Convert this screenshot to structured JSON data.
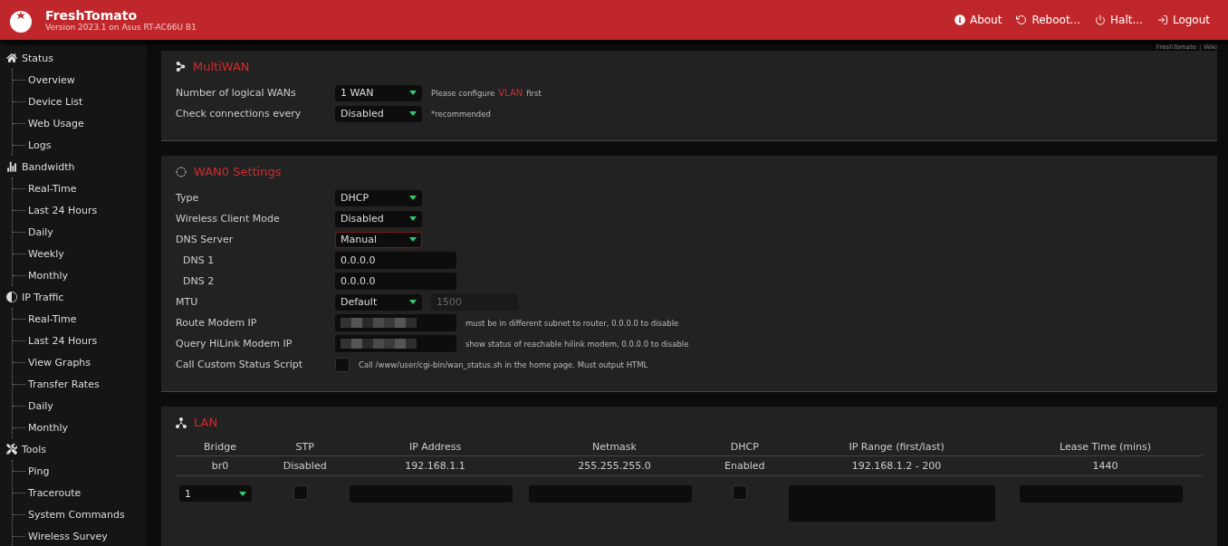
{
  "header": {
    "title": "FreshTomato",
    "subtitle": "Version 2023.1 on Asus RT-AC66U B1",
    "actions": [
      {
        "kind": "about",
        "label": "About"
      },
      {
        "kind": "reboot",
        "label": "Reboot..."
      },
      {
        "kind": "halt",
        "label": "Halt..."
      },
      {
        "kind": "logout",
        "label": "Logout"
      }
    ]
  },
  "top_links": [
    "FreshTomato",
    "|",
    "Wiki"
  ],
  "sidebar": {
    "groups": [
      {
        "kind": "status",
        "label": "Status",
        "children": [
          "Overview",
          "Device List",
          "Web Usage",
          "Logs"
        ]
      },
      {
        "kind": "bandwidth",
        "label": "Bandwidth",
        "children": [
          "Real-Time",
          "Last 24 Hours",
          "Daily",
          "Weekly",
          "Monthly"
        ]
      },
      {
        "kind": "traffic",
        "label": "IP Traffic",
        "children": [
          "Real-Time",
          "Last 24 Hours",
          "View Graphs",
          "Transfer Rates",
          "Daily",
          "Monthly"
        ]
      },
      {
        "kind": "tools",
        "label": "Tools",
        "children": [
          "Ping",
          "Traceroute",
          "System Commands",
          "Wireless Survey"
        ]
      }
    ]
  },
  "multiwan": {
    "title": "MultiWAN",
    "rows": [
      {
        "kind": "select",
        "label": "Number of logical WANs",
        "value": "1 WAN",
        "note": "Please configure",
        "link": "VLAN",
        "note_after": "first"
      },
      {
        "kind": "select",
        "label": "Check connections every",
        "value": "Disabled",
        "note": "*recommended"
      }
    ]
  },
  "wan0": {
    "title": "WAN0 Settings",
    "rows": [
      {
        "kind": "select",
        "label": "Type",
        "value": "DHCP"
      },
      {
        "kind": "select",
        "label": "Wireless Client Mode",
        "value": "Disabled"
      },
      {
        "kind": "select",
        "label": "DNS Server",
        "value": "Manual",
        "focused": true,
        "children": [
          {
            "kind": "input",
            "label": "DNS 1",
            "value": "0.0.0.0"
          },
          {
            "kind": "input",
            "label": "DNS 2",
            "value": "0.0.0.0"
          }
        ]
      },
      {
        "kind": "select",
        "label": "MTU",
        "value": "Default",
        "extra": {
          "placeholder": "1500",
          "disabled": true
        }
      },
      {
        "kind": "input",
        "label": "Route Modem IP",
        "redacted": true,
        "note": "must be in different subnet to router, 0.0.0.0 to disable"
      },
      {
        "kind": "input",
        "label": "Query HiLink Modem IP",
        "redacted": true,
        "note": "show status of reachable hilink modem, 0.0.0.0 to disable"
      },
      {
        "kind": "checkbox",
        "label": "Call Custom Status Script",
        "checked": false,
        "note": "Call /www/user/cgi-bin/wan_status.sh in the home page. Must output HTML"
      }
    ]
  },
  "lan": {
    "title": "LAN",
    "columns": [
      "Bridge",
      "STP",
      "IP Address",
      "Netmask",
      "DHCP",
      "IP Range (first/last)",
      "Lease Time (mins)"
    ],
    "rows": [
      [
        "br0",
        "Disabled",
        "192.168.1.1",
        "255.255.255.0",
        "Enabled",
        "192.168.1.2 - 200",
        "1440"
      ]
    ],
    "new_row": [
      {
        "kind": "select",
        "value": "1"
      },
      {
        "kind": "checkbox",
        "checked": false
      },
      {
        "kind": "input"
      },
      {
        "kind": "input"
      },
      {
        "kind": "checkbox",
        "checked": false
      },
      {
        "kind": "tall_input"
      },
      {
        "kind": "input"
      }
    ]
  }
}
